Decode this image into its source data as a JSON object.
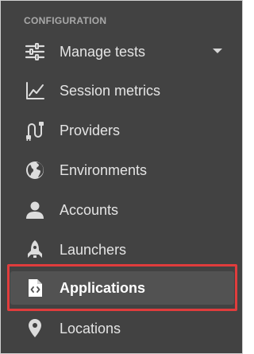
{
  "sidebar": {
    "section_header": "CONFIGURATION",
    "items": [
      {
        "label": "Manage tests",
        "icon": "sliders-icon",
        "has_dropdown": true
      },
      {
        "label": "Session metrics",
        "icon": "line-chart-icon"
      },
      {
        "label": "Providers",
        "icon": "power-cable-icon"
      },
      {
        "label": "Environments",
        "icon": "globe-icon"
      },
      {
        "label": "Accounts",
        "icon": "person-icon"
      },
      {
        "label": "Launchers",
        "icon": "rocket-icon"
      },
      {
        "label": "Applications",
        "icon": "code-file-icon",
        "selected": true
      },
      {
        "label": "Locations",
        "icon": "map-pin-icon"
      }
    ]
  },
  "colors": {
    "sidebar_background": "#424242",
    "selected_background": "#525252",
    "highlight_border": "#e03c3c",
    "icon_color": "#dcdcdc",
    "section_header": "#a9a9a9"
  }
}
